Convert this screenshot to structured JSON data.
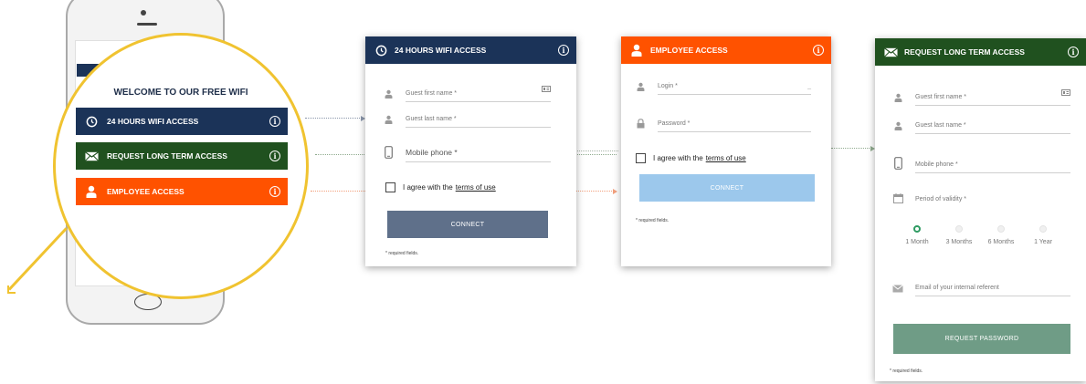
{
  "phone": {
    "title": "WELCOME TO OUR FREE WIFI",
    "buttons": [
      {
        "label": "24 HOURS WIFI ACCESS",
        "icon": "clock-icon",
        "color": "#1b3358"
      },
      {
        "label": "REQUEST LONG TERM ACCESS",
        "icon": "envelope-icon",
        "color": "#20511f"
      },
      {
        "label": "EMPLOYEE ACCESS",
        "icon": "user-icon",
        "color": "#ff5200"
      }
    ]
  },
  "wifi_card": {
    "title": "24 HOURS WIFI ACCESS",
    "first_name": "Guest first name *",
    "last_name": "Guest last name *",
    "mobile": "Mobile phone *",
    "agree_prefix": "I agree with the",
    "terms": "terms of use",
    "connect": "CONNECT",
    "required": "* required fields.",
    "header_color": "#1b3358",
    "button_color": "#5f708a"
  },
  "employee_card": {
    "title": "EMPLOYEE ACCESS",
    "login": "Login *",
    "login_suffix": "_",
    "password": "Password *",
    "agree_prefix": "I agree with the",
    "terms": "terms of use",
    "connect": "CONNECT",
    "required": "* required fields.",
    "header_color": "#ff5200",
    "button_color": "#9cc8ec"
  },
  "longterm_card": {
    "title": "REQUEST LONG TERM ACCESS",
    "first_name": "Guest first name *",
    "last_name": "Guest last name *",
    "mobile": "Mobile phone *",
    "validity": "Period of validity *",
    "options": [
      "1 Month",
      "3 Months",
      "6 Months",
      "1 Year"
    ],
    "selected_option": "1 Month",
    "referent": "Email of your internal referent",
    "request": "REQUEST PASSWORD",
    "required": "* required fields.",
    "header_color": "#20511f",
    "button_color": "#6f9c86"
  },
  "info_icon_glyph": "i"
}
